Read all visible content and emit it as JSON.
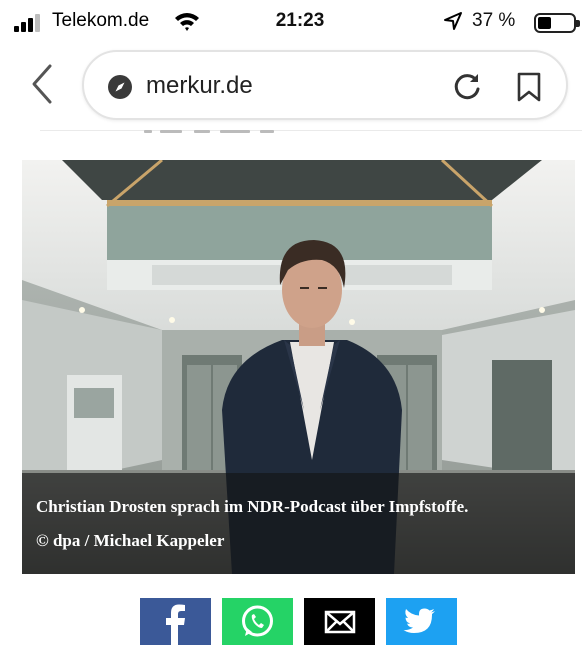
{
  "status_bar": {
    "carrier": "Telekom.de",
    "time": "21:23",
    "battery_percent": "37 %",
    "battery_level": 0.37
  },
  "browser": {
    "url": "merkur.de"
  },
  "article": {
    "image_caption": "Christian Drosten sprach im NDR-Podcast über Impfstoffe.",
    "image_credit": "© dpa / Michael Kappeler"
  },
  "share": {
    "buttons": [
      {
        "network": "facebook",
        "icon": "facebook-icon",
        "color": "#3b5998"
      },
      {
        "network": "whatsapp",
        "icon": "whatsapp-icon",
        "color": "#25d366"
      },
      {
        "network": "email",
        "icon": "envelope-icon",
        "color": "#000000"
      },
      {
        "network": "twitter",
        "icon": "twitter-bird-icon",
        "color": "#1da1f2"
      }
    ]
  }
}
